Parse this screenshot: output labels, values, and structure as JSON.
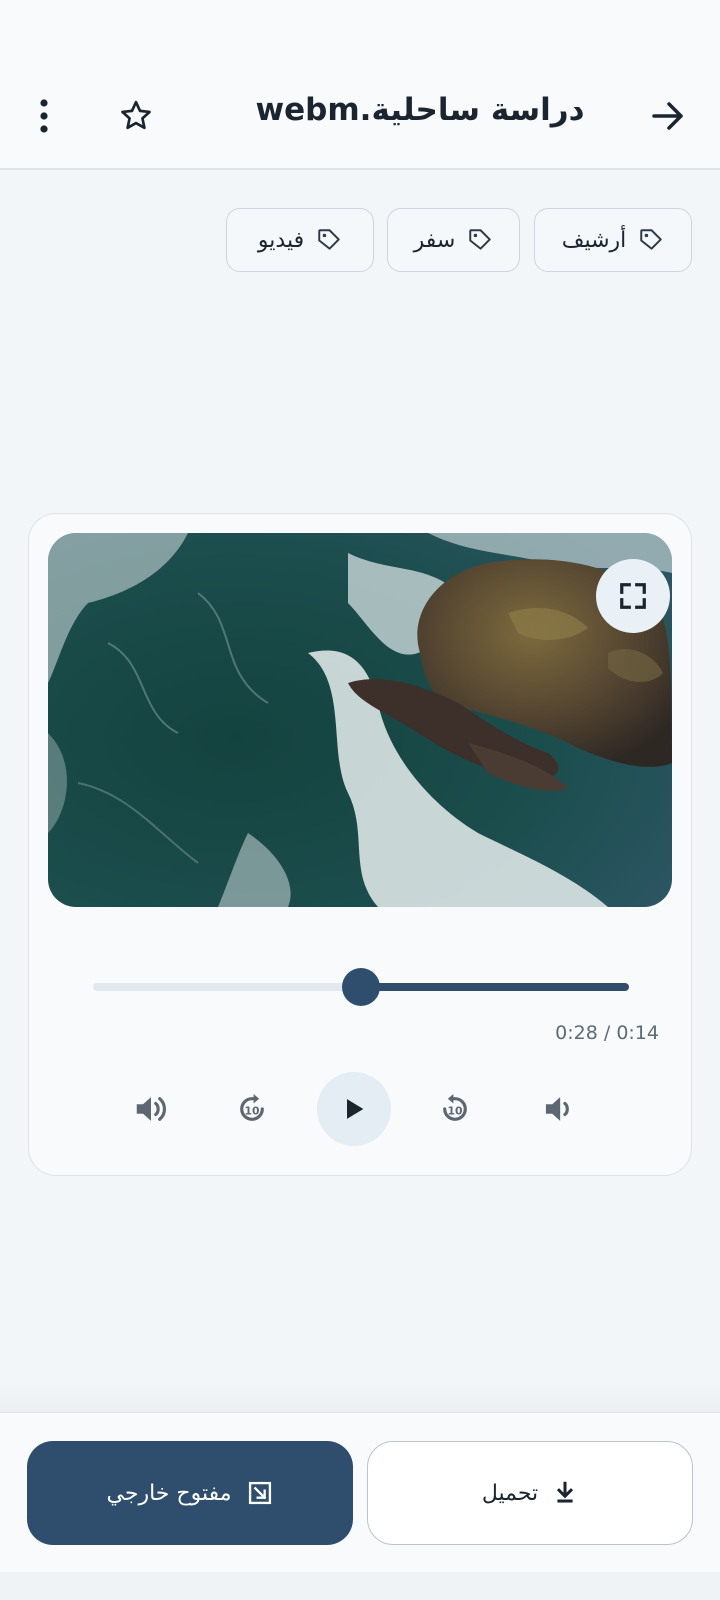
{
  "header": {
    "title": "دراسة ساحلية.webm",
    "back_icon": "arrow-right-icon",
    "star_icon": "star-outline-icon",
    "more_icon": "more-vertical-icon"
  },
  "tags": [
    {
      "label": "أرشيف"
    },
    {
      "label": "سفر"
    },
    {
      "label": "فيديو"
    }
  ],
  "player": {
    "time_text": "0:28 / 0:14",
    "progress_fraction": 0.5,
    "controls": {
      "volume_up": "volume-up-icon",
      "forward_10": "forward-10-icon",
      "play": "play-icon",
      "replay_10": "replay-10-icon",
      "volume_down": "volume-down-icon",
      "fullscreen": "fullscreen-icon"
    }
  },
  "actions": {
    "download_label": "تحميل",
    "open_external_label": "مفتوح خارجي"
  },
  "colors": {
    "primary": "#2f4d6c",
    "background": "#f2f6f9"
  }
}
